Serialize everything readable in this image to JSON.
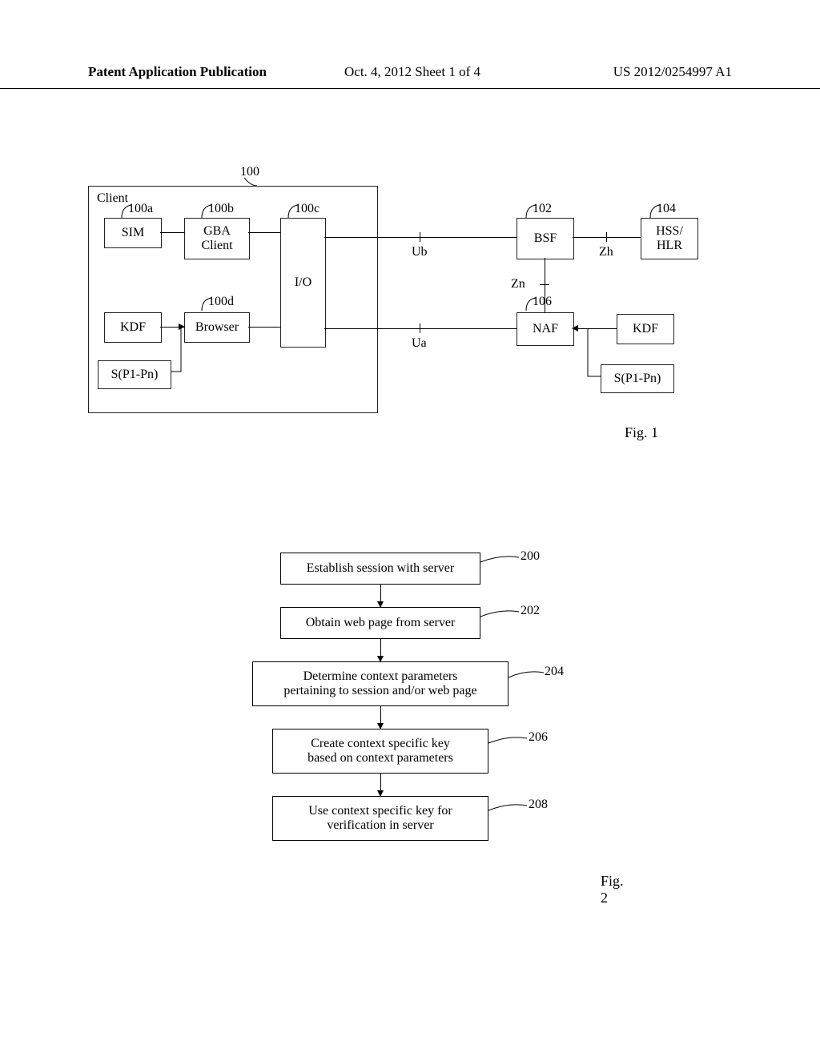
{
  "header": {
    "left": "Patent Application Publication",
    "center": "Oct. 4, 2012  Sheet 1 of 4",
    "right": "US 2012/0254997 A1"
  },
  "fig1": {
    "client_title": "Client",
    "ref_100": "100",
    "ref_100a": "100a",
    "ref_100b": "100b",
    "ref_100c": "100c",
    "ref_100d": "100d",
    "ref_102": "102",
    "ref_104": "104",
    "ref_106": "106",
    "sim": "SIM",
    "gba": "GBA\nClient",
    "io": "I/O",
    "kdf_left": "KDF",
    "browser": "Browser",
    "bsf": "BSF",
    "hss": "HSS/\nHLR",
    "naf": "NAF",
    "kdf_right": "KDF",
    "sp_left": "S(P1-Pn)",
    "sp_right": "S(P1-Pn)",
    "ub": "Ub",
    "zh": "Zh",
    "zn": "Zn",
    "ua": "Ua",
    "caption": "Fig. 1"
  },
  "fig2": {
    "step200": {
      "num": "200",
      "text": "Establish session with server"
    },
    "step202": {
      "num": "202",
      "text": "Obtain web page from server"
    },
    "step204": {
      "num": "204",
      "text": "Determine context parameters\npertaining to session and/or web page"
    },
    "step206": {
      "num": "206",
      "text": "Create context specific key\nbased on context parameters"
    },
    "step208": {
      "num": "208",
      "text": "Use context specific key for\nverification in server"
    },
    "caption": "Fig. 2"
  }
}
